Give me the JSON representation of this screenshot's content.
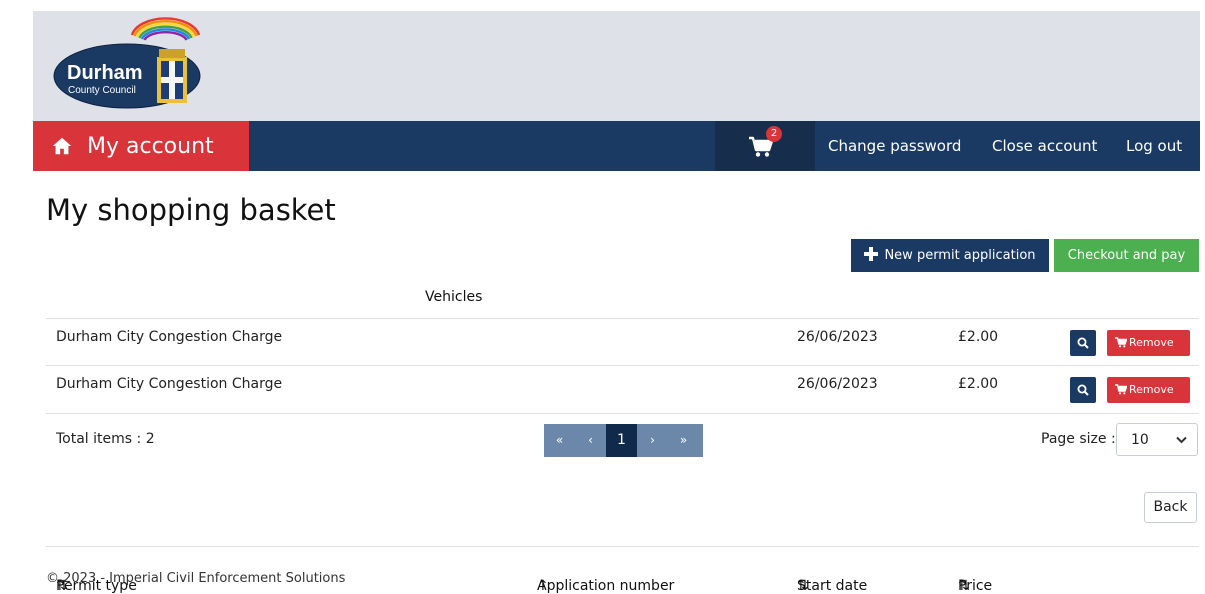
{
  "logo": {
    "name": "Durham",
    "sub": "County Council"
  },
  "nav": {
    "my_account": "My account",
    "cart_count": "2",
    "change_password": "Change password",
    "close_account": "Close account",
    "log_out": "Log out"
  },
  "page": {
    "title": "My shopping basket"
  },
  "actions": {
    "new_permit": "New permit application",
    "checkout": "Checkout and pay"
  },
  "table": {
    "headers": {
      "permit_type": "Permit type",
      "vehicles": "Vehicles",
      "application_number": "Application number",
      "start_date": "Start date",
      "price": "Price"
    },
    "rows": [
      {
        "permit_type": "Durham City Congestion Charge",
        "vehicles": "",
        "application_number": "",
        "start_date": "26/06/2023",
        "price": "£2.00",
        "remove": "Remove"
      },
      {
        "permit_type": "Durham City Congestion Charge",
        "vehicles": "",
        "application_number": "",
        "start_date": "26/06/2023",
        "price": "£2.00",
        "remove": "Remove"
      }
    ]
  },
  "pagination": {
    "total": "Total items : 2",
    "first": "«",
    "prev": "‹",
    "current": "1",
    "next": "›",
    "last": "»",
    "page_size_label": "Page size :",
    "page_size": "10"
  },
  "back": "Back",
  "footer": "© 2023 - Imperial Civil Enforcement Solutions",
  "colors": {
    "navy": "#1b3a63",
    "red": "#d9343a",
    "green": "#4caf50",
    "header_bg": "#dfe1e8"
  }
}
